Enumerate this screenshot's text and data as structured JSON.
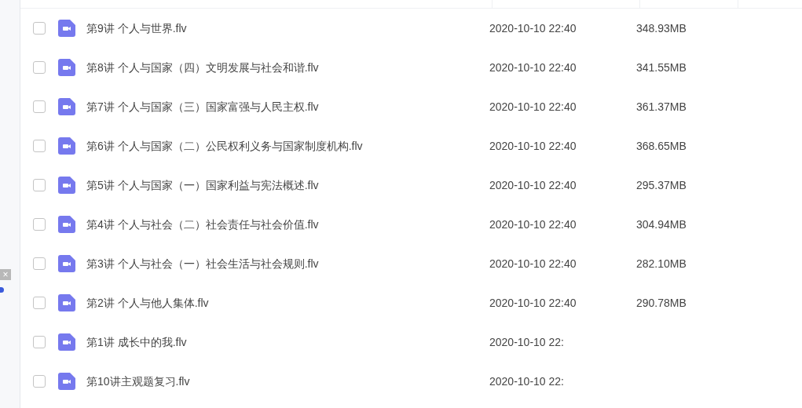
{
  "files": [
    {
      "name": "第9讲 个人与世界.flv",
      "modified": "2020-10-10 22:40",
      "size": "348.93MB",
      "checked": false
    },
    {
      "name": "第8讲 个人与国家（四）文明发展与社会和谐.flv",
      "modified": "2020-10-10 22:40",
      "size": "341.55MB",
      "checked": false
    },
    {
      "name": "第7讲 个人与国家（三）国家富强与人民主权.flv",
      "modified": "2020-10-10 22:40",
      "size": "361.37MB",
      "checked": false
    },
    {
      "name": "第6讲 个人与国家（二）公民权利义务与国家制度机构.flv",
      "modified": "2020-10-10 22:40",
      "size": "368.65MB",
      "checked": false
    },
    {
      "name": "第5讲 个人与国家（一）国家利益与宪法概述.flv",
      "modified": "2020-10-10 22:40",
      "size": "295.37MB",
      "checked": false
    },
    {
      "name": "第4讲 个人与社会（二）社会责任与社会价值.flv",
      "modified": "2020-10-10 22:40",
      "size": "304.94MB",
      "checked": false
    },
    {
      "name": "第3讲 个人与社会（一）社会生活与社会规则.flv",
      "modified": "2020-10-10 22:40",
      "size": "282.10MB",
      "checked": false
    },
    {
      "name": "第2讲 个人与他人集体.flv",
      "modified": "2020-10-10 22:40",
      "size": "290.78MB",
      "checked": false
    },
    {
      "name": "第1讲 成长中的我.flv",
      "modified": "2020-10-10 22:",
      "checked": false
    },
    {
      "name": "第10讲主观题复习.flv",
      "modified": "2020-10-10 22:",
      "checked": false
    }
  ],
  "side_close": "×"
}
